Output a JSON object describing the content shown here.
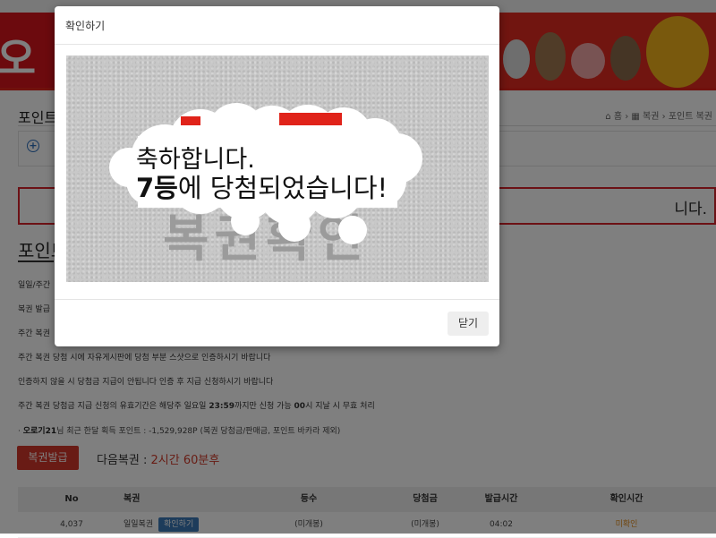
{
  "page": {
    "section_title": "포인트 복권",
    "breadcrumb": {
      "home": "홈",
      "mid": "복권",
      "last": "포인트 복권"
    },
    "notice_tail": "니다.",
    "sub_title": "포인트",
    "info_lines": {
      "line1": "일일/주간",
      "line2": "복권 발급",
      "line3": "주간 복권",
      "line4": "주간 복권 당첨 시에 자유게시판에 당첨 부분 스샷으로 인증하시기 바랍니다",
      "line5": "인증하지 않을 시 당첨금 지급이 안됩니다 인증 후 지급 신청하시기 바랍니다",
      "line6_pre": "주간 복권 당첨금 지급 신청의 유효기간은 해당주 일요일 ",
      "line6_b1": "23:59",
      "line6_mid": "까지만 신청 가능 ",
      "line6_b2": "00",
      "line6_post": "시 지날 시 무효 처리"
    },
    "point_row": {
      "user": "오로기21",
      "text": "님 최근 한달 획득 포인트 : -1,529,928P (복권 당첨금/판매금, 포인트 바카라 제외)"
    },
    "issue_button": "복권발급",
    "next_label": "다음복권 : ",
    "next_value": "2시간 60분후",
    "table": {
      "headers": {
        "no": "No",
        "name": "복권",
        "rank": "등수",
        "win": "당첨금",
        "issued": "발급시간",
        "checked": "확인시간"
      },
      "row": {
        "no": "4,037",
        "name": "일일복권",
        "confirm": "확인하기",
        "rank": "(미개봉)",
        "win": "(미개봉)",
        "issued": "04:02",
        "checked": "미확인"
      }
    }
  },
  "modal": {
    "title": "확인하기",
    "message_line1": "축하합니다.",
    "message_rank": "7등",
    "message_line2": "에 당첨되었습니다!",
    "ghost_text": "복권확인",
    "close_label": "닫기"
  }
}
